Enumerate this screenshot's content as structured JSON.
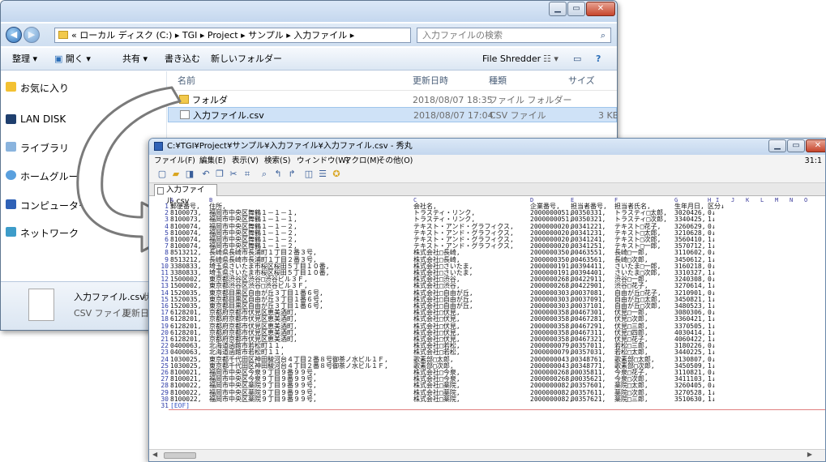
{
  "explorer": {
    "address": "« ローカル ディスク (C:) ▸ TGI ▸ Project ▸ サンプル ▸ 入力ファイル ▸",
    "search_placeholder": "入力ファイルの検索",
    "toolbar": {
      "organize": "整理 ▾",
      "open": "開く ▾",
      "share": "共有 ▾",
      "burn": "書き込む",
      "new_folder": "新しいフォルダー",
      "file_shredder": "File Shredder"
    },
    "nav": [
      "お気に入り",
      "LAN DISK",
      "ライブラリ",
      "ホームグループ",
      "コンピューター",
      "ネットワーク"
    ],
    "columns": {
      "name": "名前",
      "date": "更新日時",
      "type": "種類",
      "size": "サイズ"
    },
    "files": [
      {
        "name": "フォルダ",
        "date": "2018/08/07 18:35",
        "type": "ファイル フォルダー",
        "size": ""
      },
      {
        "name": "入力ファイル.csv",
        "date": "2018/08/07 17:04",
        "type": "CSV ファイル",
        "size": "3 KB"
      }
    ],
    "details": {
      "name": "入力ファイル.csv",
      "status_label": "状",
      "type": "CSV ファイル",
      "modified_label": "更新日"
    }
  },
  "editor": {
    "title": "C:¥TGI¥Project¥サンプル¥入力ファイル¥入力ファイル.csv - 秀丸",
    "menu": [
      "ファイル(F)",
      "編集(E)",
      "表示(V)",
      "検索(S)",
      "ウィンドウ(W)",
      "マクロ(M)",
      "その他(O)"
    ],
    "cursor_pos": "31:1",
    "tab": "入力ファイル.csv",
    "ruler": [
      "A",
      "B",
      "C",
      "D",
      "E",
      "F",
      "G",
      "H",
      "I",
      "J",
      "K",
      "L",
      "M",
      "N",
      "O"
    ],
    "eof": "[EOF]",
    "rows": [
      [
        "郵便番号,",
        "住所,",
        "会社名,",
        "企業番号,",
        "担当者番号,",
        "担当者氏名,",
        "生年月日,",
        "区分↓"
      ],
      [
        "8100073,",
        "福岡市中央区舞鶴１－１－１,",
        "トラスティ・リンク,",
        "2000000051,",
        "00350331,",
        "トラスティ□太郎,",
        "3020426,",
        "0↓"
      ],
      [
        "8100073,",
        "福岡市中央区舞鶴１－１－１,",
        "トラスティ・リンク,",
        "2000000051,",
        "00350321,",
        "トラスティ□次郎,",
        "3340425,",
        "1↓"
      ],
      [
        "8100074,",
        "福岡市中央区舞鶴１－１－２,",
        "テキスト・アンド・グラフィクス,",
        "2000000020,",
        "00341221,",
        "テキスト□花子,",
        "3260629,",
        "0↓"
      ],
      [
        "8100074,",
        "福岡市中央区舞鶴１－１－２,",
        "テキスト・アンド・グラフィクス,",
        "2000000020,",
        "00341231,",
        "テキスト□太郎,",
        "3210628,",
        "0↓"
      ],
      [
        "8100074,",
        "福岡市中央区舞鶴１－１－２,",
        "テキスト・アンド・グラフィクス,",
        "2000000020,",
        "00341241,",
        "テキスト□次郎,",
        "3560410,",
        "1↓"
      ],
      [
        "8100074,",
        "福岡市中央区舞鶴１－１－２,",
        "テキスト・アンド・グラフィクス,",
        "2000000020,",
        "00341251,",
        "テキスト□一郎,",
        "3570712,",
        "1↓"
      ],
      [
        "8513212,",
        "長崎県長崎市長浦町１丁目２番３号,",
        "株式会社□長崎,",
        "2000000350,",
        "00463551,",
        "長崎□一郎,",
        "3110602,",
        "0↓"
      ],
      [
        "8513212,",
        "長崎県長崎市長浦町１丁目２番３号,",
        "株式会社□長崎,",
        "2000000350,",
        "00463561,",
        "長崎□次郎,",
        "3450612,",
        "1↓"
      ],
      [
        "3380833,",
        "埼玉県さいたま市桜区桜田５丁目１０番,",
        "株式会社□さいたま,",
        "2000000191,",
        "00394411,",
        "さいたま□一郎,",
        "3160218,",
        "0↓"
      ],
      [
        "3380833,",
        "埼玉県さいたま市桜区桜田５丁目１０番,",
        "株式会社□さいたま,",
        "2000000191,",
        "00394401,",
        "さいたま□次郎,",
        "3310327,",
        "1↓"
      ],
      [
        "1500002,",
        "東京都渋谷区渋谷□渋谷ビル３Ｆ,",
        "株式会社□渋谷,",
        "2000000268,",
        "00422911,",
        "渋谷□一郎,",
        "3240308,",
        "0↓"
      ],
      [
        "1500002,",
        "東京都渋谷区渋谷□渋谷ビル３Ｆ,",
        "株式会社□渋谷,",
        "2000000268,",
        "00422901,",
        "渋谷□花子,",
        "3270614,",
        "1↓"
      ],
      [
        "1520035,",
        "東京都目黒区自由が丘３丁目１番６号,",
        "株式会社□自由が丘,",
        "2000000303,",
        "00037081,",
        "自由が丘□花子,",
        "3210901,",
        "0↓"
      ],
      [
        "1520035,",
        "東京都目黒区自由が丘３丁目１番６号,",
        "株式会社□自由が丘,",
        "2000000303,",
        "00037091,",
        "自由が丘□太郎,",
        "3450821,",
        "1↓"
      ],
      [
        "1520035,",
        "東京都目黒区自由が丘３丁目１番６号,",
        "株式会社□自由が丘,",
        "2000000303,",
        "00037101,",
        "自由が丘□次郎,",
        "3480523,",
        "1↓"
      ],
      [
        "6128201,",
        "京都府京都市伏見区恵美酒町,",
        "株式会社□伏見,",
        "2000000358,",
        "00467301,",
        "伏見□一郎,",
        "3080306,",
        "0↓"
      ],
      [
        "6128201,",
        "京都府京都市伏見区恵美酒町,",
        "株式会社□伏見,",
        "2000000358,",
        "00467281,",
        "伏見□次郎,",
        "3360421,",
        "1↓"
      ],
      [
        "6128201,",
        "京都府京都市伏見区恵美酒町,",
        "株式会社□伏見,",
        "2000000358,",
        "00467291,",
        "伏見□三郎,",
        "3370505,",
        "1↓"
      ],
      [
        "6128201,",
        "京都府京都市伏見区恵美酒町,",
        "株式会社□伏見,",
        "2000000358,",
        "00467311,",
        "伏見□四郎,",
        "4030414,",
        "1↓"
      ],
      [
        "6128201,",
        "京都府京都市伏見区恵美酒町,",
        "株式会社□伏見,",
        "2000000358,",
        "00467321,",
        "伏見□花子,",
        "4060422,",
        "1↓"
      ],
      [
        "0400063,",
        "北海道函館市若松町１１,",
        "株式会社□若松,",
        "2000000079,",
        "00357011,",
        "若松□三郎,",
        "3180226,",
        "0↓"
      ],
      [
        "0400063,",
        "北海道函館市若松町１１,",
        "株式会社□若松,",
        "2000000079,",
        "00357031,",
        "若松□太郎,",
        "3440225,",
        "1↓"
      ],
      [
        "1030025,",
        "東京都千代田区神田駿河台４丁目２番８号御茶ノ水ビル１Ｆ,",
        "歌素部□太郎,",
        "2000000043,",
        "00348761,",
        "歌素部□太郎,",
        "3130807,",
        "0↓"
      ],
      [
        "1030025,",
        "東京都千代田区神田駿河台４丁目２番８号御茶ノ水ビル１Ｆ,",
        "歌素部□次郎,",
        "2000000043,",
        "00348771,",
        "歌素部□次郎,",
        "3450509,",
        "1↓"
      ],
      [
        "8100021,",
        "福岡市中央区今泉９丁目９番９９号,",
        "株式会社□今泉,",
        "2000000268,",
        "00035811,",
        "今泉□花子,",
        "3110821,",
        "0↓"
      ],
      [
        "8100021,",
        "福岡市中央区今泉９丁目９番９９号,",
        "株式会社□今泉,",
        "2000000268,",
        "00035621,",
        "今泉□次郎,",
        "3411103,",
        "1↓"
      ],
      [
        "8100022,",
        "福岡市中央区薬院９丁目９番９９号,",
        "株式会社□薬院,",
        "2000000082,",
        "00357601,",
        "薬院□太郎,",
        "3260405,",
        "0↓"
      ],
      [
        "8100022,",
        "福岡市中央区薬院９丁目９番９９号,",
        "株式会社□薬院,",
        "2000000082,",
        "00357611,",
        "薬院□次郎,",
        "3270528,",
        "1↓"
      ],
      [
        "8100022,",
        "福岡市中央区薬院９丁目９番９９号,",
        "株式会社□薬院,",
        "2000000082,",
        "00357621,",
        "薬院□三郎,",
        "3510630,",
        "1↓"
      ]
    ]
  },
  "colors": {
    "selection": "#cfe2f7",
    "line_numbers": "#2d3ba7",
    "arrow_stroke": "#7a7a7a"
  }
}
